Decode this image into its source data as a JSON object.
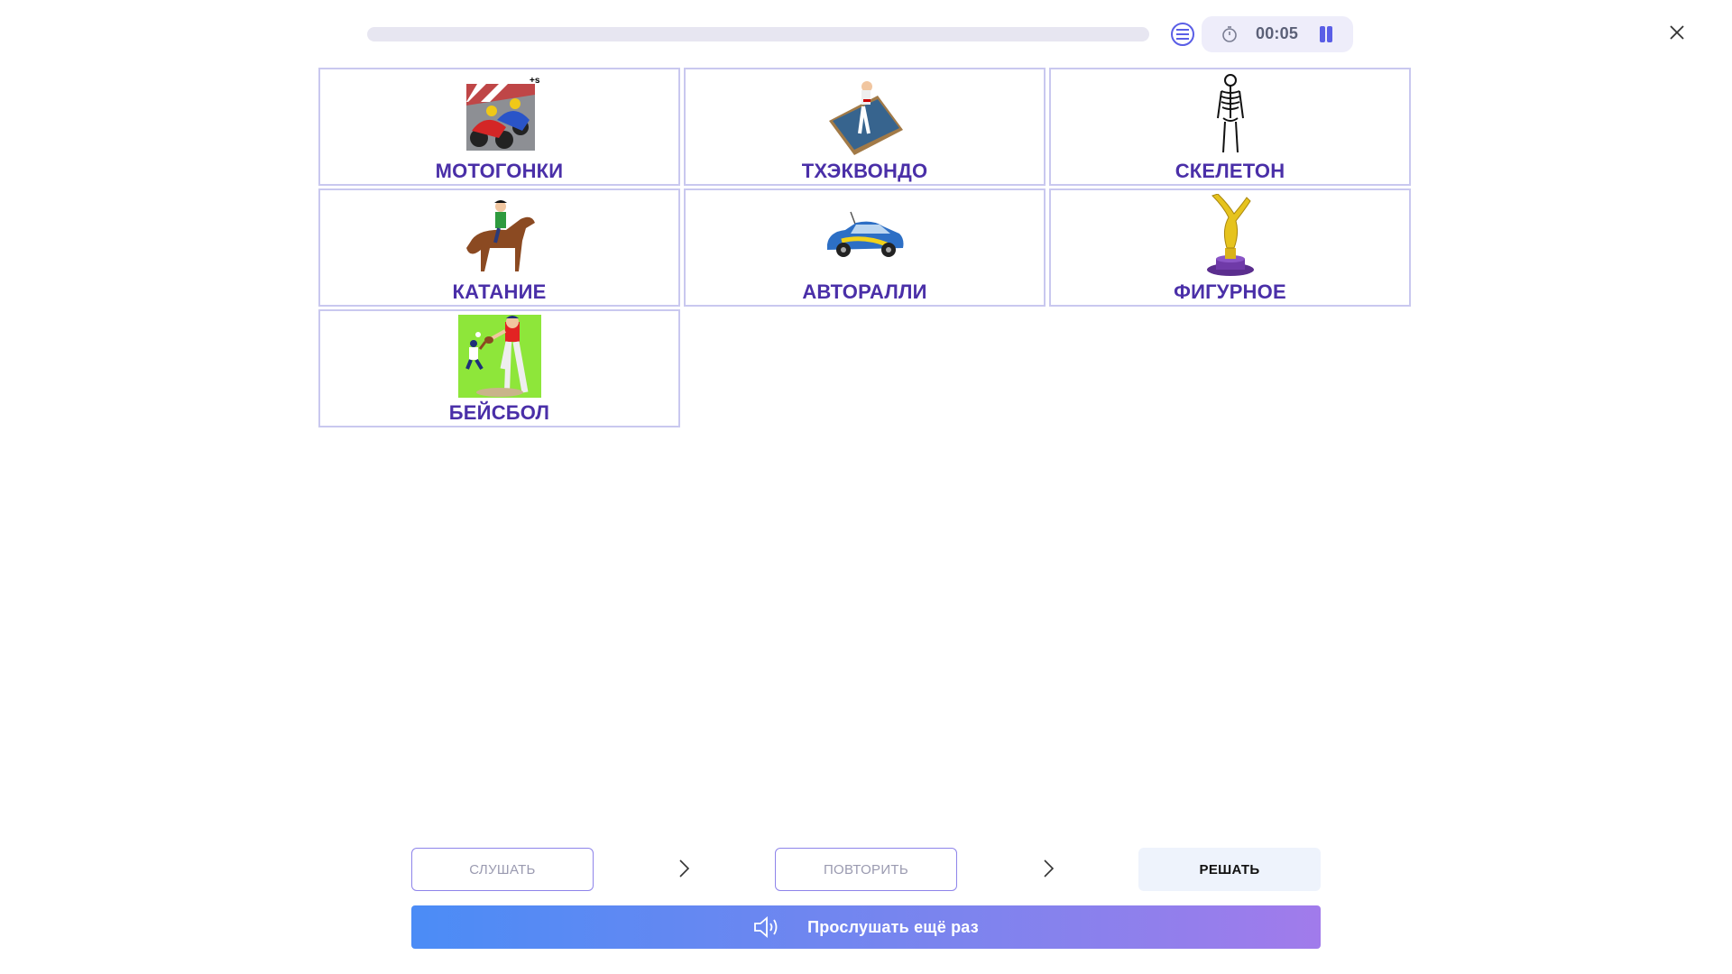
{
  "top_bar": {
    "progress_fraction": 0,
    "timer": "00:05",
    "accent_color": "#5a5ee6"
  },
  "cards": [
    {
      "label": "МОТОГОНКИ",
      "icon": "motorcycle-racing-picture"
    },
    {
      "label": "ТХЭКВОНДО",
      "icon": "taekwondo-picture"
    },
    {
      "label": "СКЕЛЕТОН",
      "icon": "skeleton-picture"
    },
    {
      "label": "КАТАНИЕ",
      "icon": "horse-riding-picture"
    },
    {
      "label": "АВТОРАЛЛИ",
      "icon": "rally-car-picture"
    },
    {
      "label": "ФИГУРНОЕ",
      "icon": "figure-skating-trophy-picture"
    },
    {
      "label": "БЕЙСБОЛ",
      "icon": "baseball-picture"
    }
  ],
  "steps": {
    "listen": "СЛУШАТЬ",
    "repeat": "ПОВТОРИТЬ",
    "solve": "РЕШАТЬ"
  },
  "listen_again": "Прослушать ещё раз"
}
